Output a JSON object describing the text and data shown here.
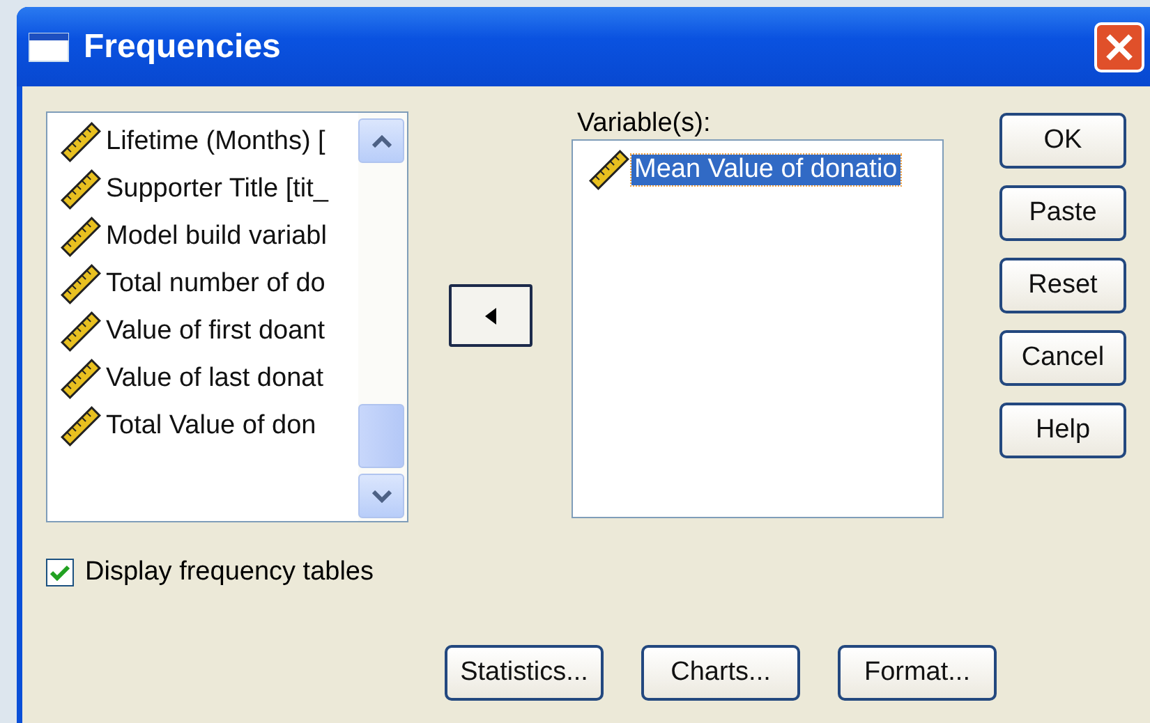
{
  "window": {
    "title": "Frequencies"
  },
  "source_list": {
    "items": [
      {
        "label": "Lifetime (Months) [",
        "selected": false
      },
      {
        "label": "Supporter Title [tit_",
        "selected": false
      },
      {
        "label": "Model build variabl",
        "selected": false
      },
      {
        "label": "Total number of do",
        "selected": false
      },
      {
        "label": "Value of first doant",
        "selected": false
      },
      {
        "label": "Value of last donat",
        "selected": false
      },
      {
        "label": "Total Value of don",
        "selected": false
      }
    ]
  },
  "variables": {
    "label": "Variable(s):",
    "items": [
      {
        "label": "Mean Value of donatio",
        "selected": true
      }
    ]
  },
  "side_buttons": [
    "OK",
    "Paste",
    "Reset",
    "Cancel",
    "Help"
  ],
  "display_frequency_tables": {
    "label": "Display frequency tables",
    "checked": true
  },
  "bottom_buttons": [
    "Statistics...",
    "Charts...",
    "Format..."
  ]
}
